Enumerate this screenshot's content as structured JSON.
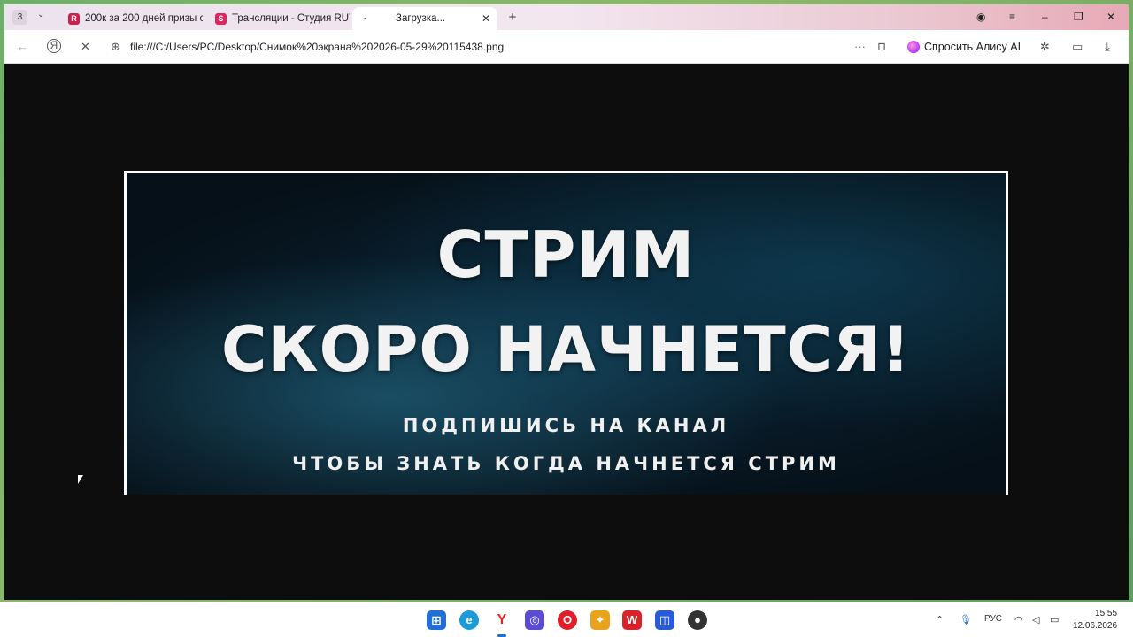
{
  "tabbar": {
    "tab_count": "3",
    "tabs": [
      {
        "label": "200к за 200 дней призы с"
      },
      {
        "label": "Трансляции - Студия RUT"
      },
      {
        "label": "Загрузка..."
      }
    ]
  },
  "address": {
    "url": "file:///C:/Users/PC/Desktop/Снимок%20экрана%202026-05-29%20115438.png",
    "alisa_label": "Спросить Алису AI"
  },
  "banner": {
    "title_line1": "СТРИМ",
    "title_line2": "СКОРО НАЧНЕТСЯ!",
    "subtitle_line1": "ПОДПИШИСЬ НА КАНАЛ",
    "subtitle_line2": "ЧТОБЫ ЗНАТЬ КОГДА НАЧНЕТСЯ СТРИМ"
  },
  "taskbar": {
    "language": "РУС",
    "time": "15:55",
    "date": "12.06.2026"
  },
  "colors": {
    "accent": "#c8214a",
    "banner_bg": "#061018"
  }
}
